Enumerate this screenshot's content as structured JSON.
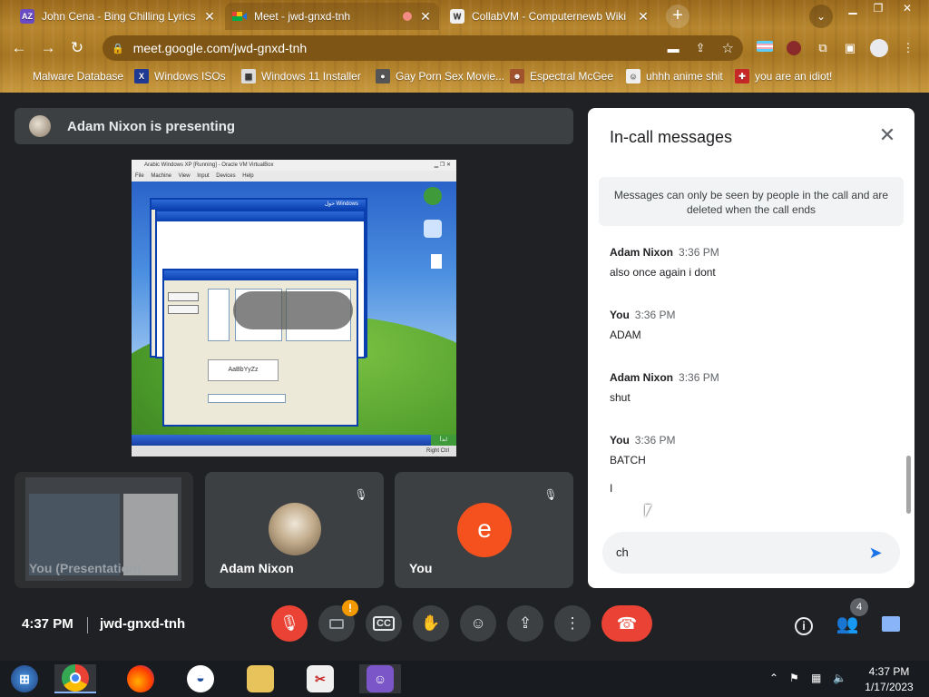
{
  "browser": {
    "tabs": [
      {
        "title": "John Cena - Bing Chilling Lyrics |",
        "favicon": "AZ"
      },
      {
        "title": "Meet - jwd-gnxd-tnh",
        "favicon": "meet"
      },
      {
        "title": "CollabVM - Computernewb Wiki",
        "favicon": "wiki"
      }
    ],
    "url": "meet.google.com/jwd-gnxd-tnh",
    "bookmarks": [
      {
        "label": "Malware Database"
      },
      {
        "label": "Windows ISOs"
      },
      {
        "label": "Windows 11 Installer"
      },
      {
        "label": "Gay Porn Sex Movie..."
      },
      {
        "label": "Espectral McGee"
      },
      {
        "label": "uhhh anime shit"
      },
      {
        "label": "you are an idiot!"
      }
    ]
  },
  "meet": {
    "presenting": "Adam Nixon is presenting",
    "shared_screen": {
      "vm_title": "Arabic Windows XP [Running] - Oracle VM VirtualBox",
      "menu": "File   Machine   View   Input   Devices   Help",
      "dialog_title": "حول Windows",
      "font_sample": "AaBbYyZz"
    },
    "tiles": [
      {
        "name": "You (Presentation)"
      },
      {
        "name": "Adam Nixon"
      },
      {
        "name": "You",
        "initial": "e"
      }
    ],
    "meeting_time": "4:37 PM",
    "meeting_code": "jwd-gnxd-tnh",
    "participants_count": "4",
    "camera_alert": "!"
  },
  "chat": {
    "title": "In-call messages",
    "notice": "Messages can only be seen by people in the call and are deleted when the call ends",
    "messages": [
      {
        "sender": "Adam Nixon",
        "time": "3:36 PM",
        "text": "also once again i dont"
      },
      {
        "sender": "You",
        "time": "3:36 PM",
        "text": "ADAM"
      },
      {
        "sender": "Adam Nixon",
        "time": "3:36 PM",
        "text": "shut"
      },
      {
        "sender": "You",
        "time": "3:36 PM",
        "text": "BATCH"
      }
    ],
    "extra_line": "I",
    "composer_value": "ch"
  },
  "taskbar": {
    "time": "4:37 PM",
    "date": "1/17/2023"
  },
  "colors": {
    "meet_bg": "#202124",
    "tile_bg": "#3c4043",
    "danger": "#ea4335",
    "accent": "#1a73e8",
    "avatar_orange": "#f4511e",
    "frame": "#b7862e"
  }
}
